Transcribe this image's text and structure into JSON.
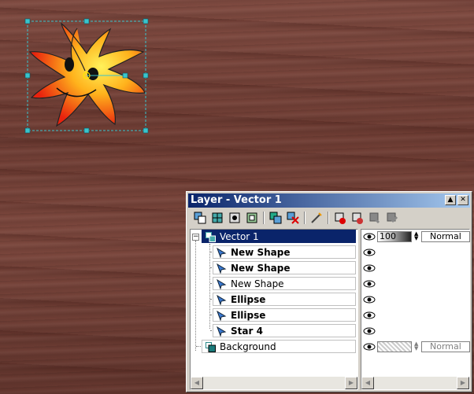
{
  "palette": {
    "title": "Layer - Vector 1",
    "minimize_icon": "minimize-icon",
    "close_icon": "close-icon",
    "toolbar_icons": [
      "new-vector-layer-icon",
      "new-raster-layer-icon",
      "new-mask-layer-icon",
      "new-adjustment-layer-icon",
      "duplicate-layer-icon",
      "delete-layer-icon",
      "edit-properties-icon",
      "lock-visibility-icon",
      "unlock-icon",
      "link-icon",
      "unlink-icon"
    ],
    "layers": [
      {
        "label": "Vector 1",
        "bold": false,
        "selected": true,
        "icon": "vector-layer-icon",
        "opacity": "100",
        "blend": "Normal"
      },
      {
        "label": "New Shape",
        "bold": true,
        "selected": false,
        "icon": "shape-icon"
      },
      {
        "label": "New Shape",
        "bold": true,
        "selected": false,
        "icon": "shape-icon"
      },
      {
        "label": "New Shape",
        "bold": false,
        "selected": false,
        "icon": "shape-icon"
      },
      {
        "label": "Ellipse",
        "bold": true,
        "selected": false,
        "icon": "shape-icon"
      },
      {
        "label": "Ellipse",
        "bold": true,
        "selected": false,
        "icon": "shape-icon"
      },
      {
        "label": "Star 4",
        "bold": true,
        "selected": false,
        "icon": "shape-icon"
      },
      {
        "label": "Background",
        "bold": false,
        "selected": false,
        "icon": "raster-layer-icon",
        "opacity": "",
        "blend": "Normal"
      }
    ]
  },
  "colors": {
    "titlebar_start": "#0a246a",
    "titlebar_end": "#a6caf0",
    "star_outer": "#e8220e",
    "star_inner": "#ffe23a"
  }
}
